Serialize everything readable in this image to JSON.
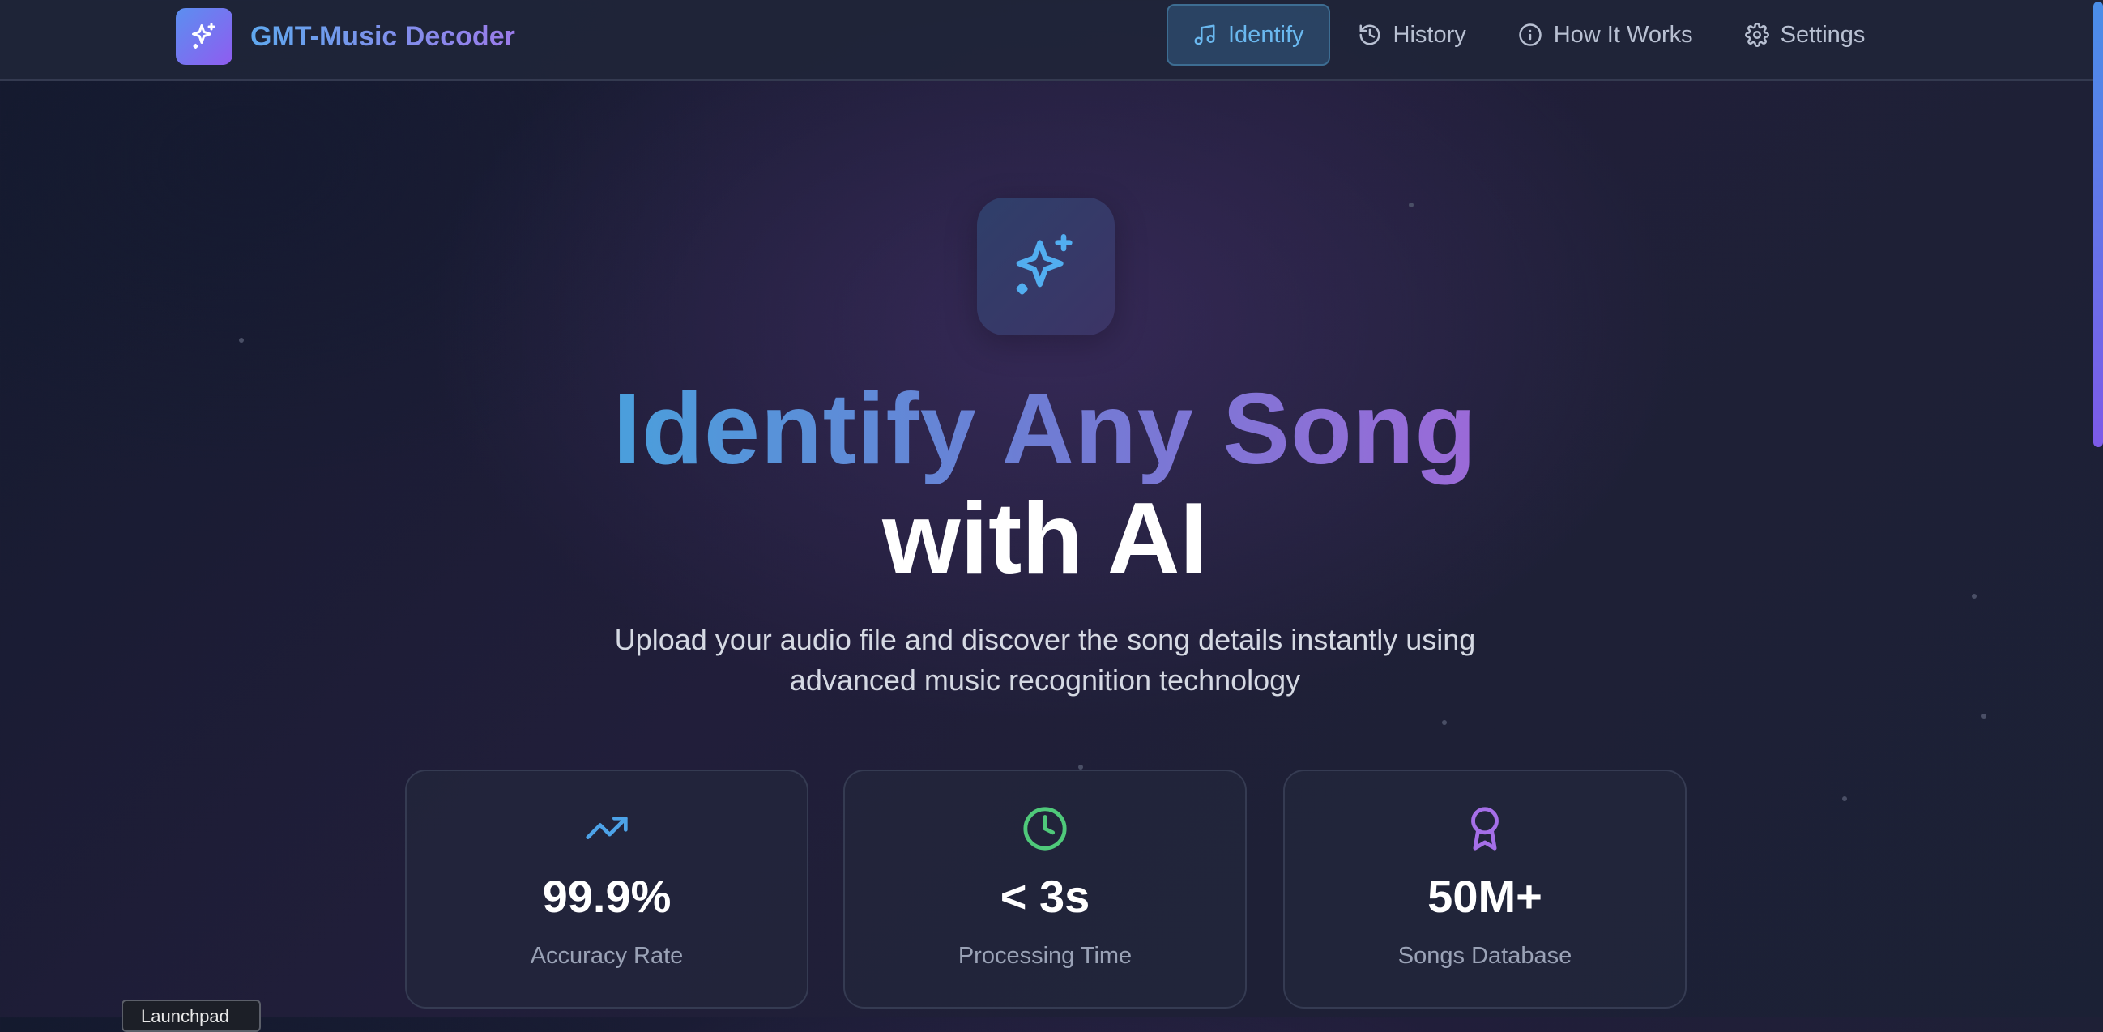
{
  "header": {
    "brand": "GMT-Music Decoder",
    "nav": [
      {
        "label": "Identify",
        "icon": "music-note-icon",
        "active": true
      },
      {
        "label": "History",
        "icon": "history-icon",
        "active": false
      },
      {
        "label": "How It Works",
        "icon": "info-icon",
        "active": false
      },
      {
        "label": "Settings",
        "icon": "gear-icon",
        "active": false
      }
    ]
  },
  "hero": {
    "icon": "sparkles-icon",
    "title_line1": "Identify Any Song",
    "title_line2": "with AI",
    "subtitle_line1": "Upload your audio file and discover the song details instantly using",
    "subtitle_line2": "advanced music recognition technology"
  },
  "stats": [
    {
      "value": "99.9%",
      "label": "Accuracy Rate",
      "icon": "trending-up-icon",
      "color": "#4da3e8"
    },
    {
      "value": "< 3s",
      "label": "Processing Time",
      "icon": "clock-icon",
      "color": "#4fc97a"
    },
    {
      "value": "50M+",
      "label": "Songs Database",
      "icon": "award-icon",
      "color": "#a56fe8"
    }
  ],
  "tooltip": {
    "label": "Launchpad"
  },
  "colors": {
    "accent_blue": "#4da3e8",
    "accent_purple": "#9b6ad8",
    "background": "#1d2036"
  }
}
